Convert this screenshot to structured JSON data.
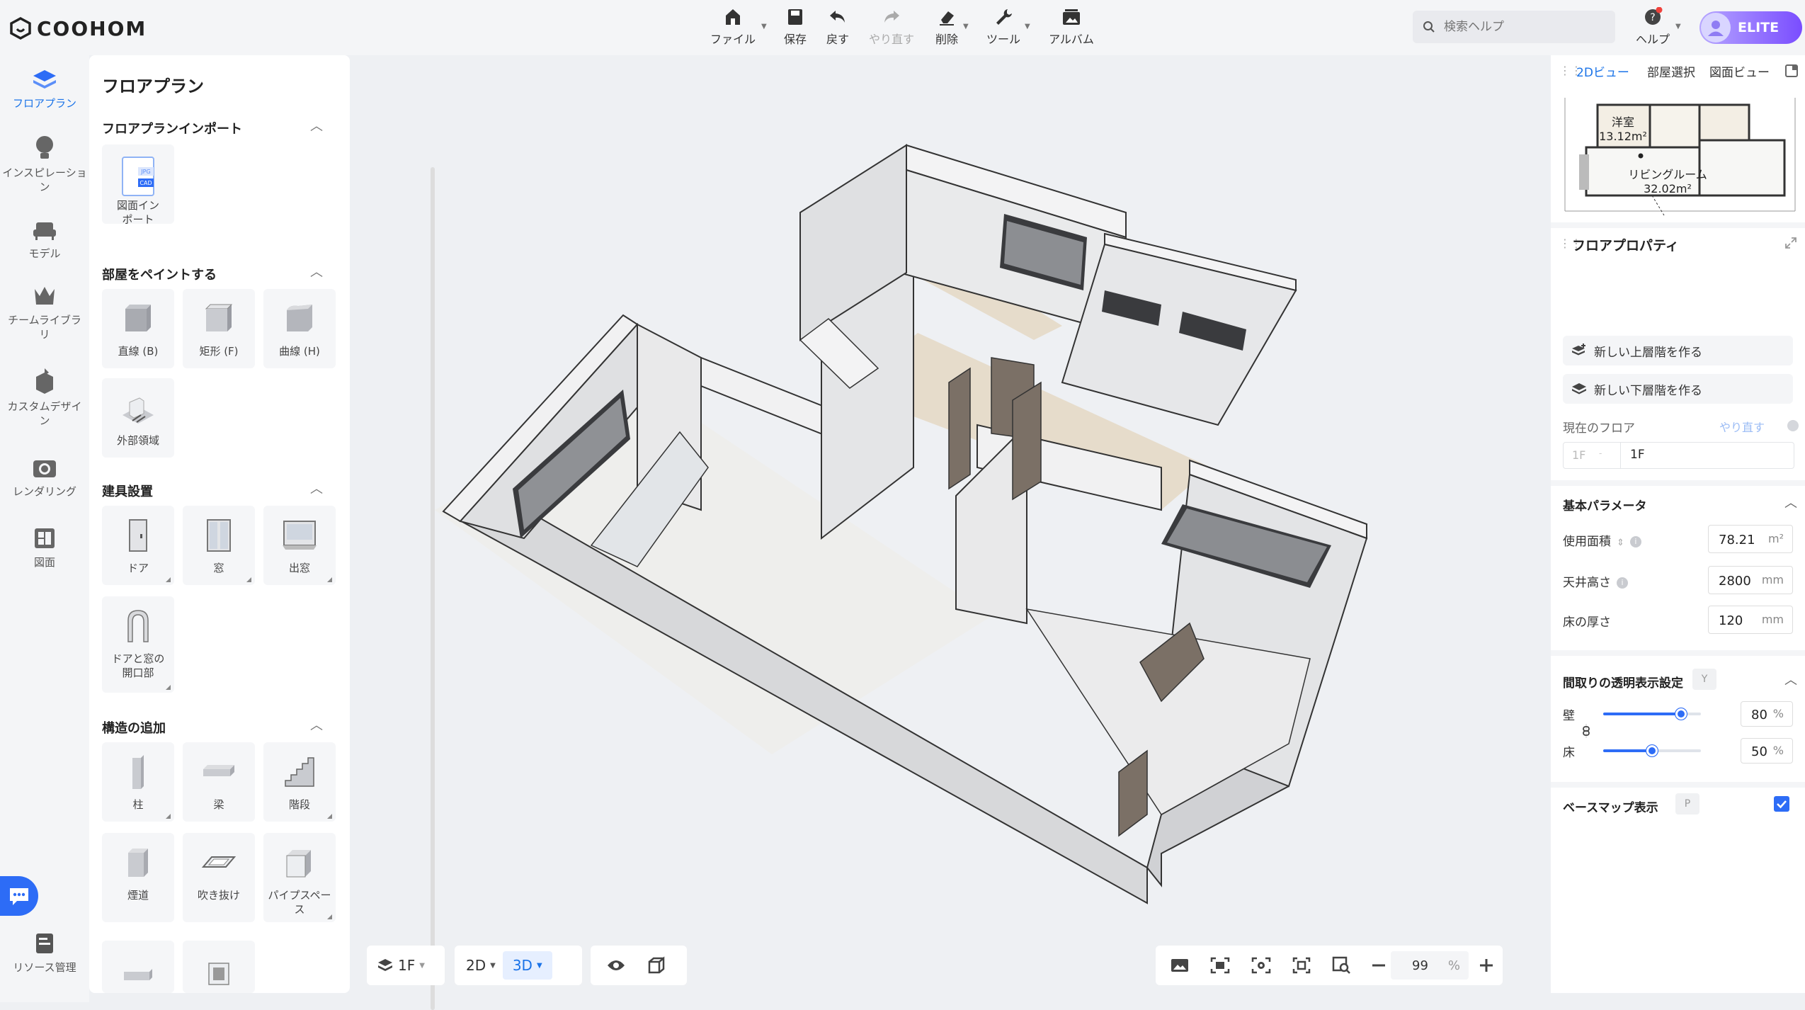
{
  "app": {
    "logo_text": "COOHOM"
  },
  "toolbar": {
    "file": "ファイル",
    "save": "保存",
    "undo": "戻す",
    "redo": "やり直す",
    "delete": "削除",
    "tools": "ツール",
    "album": "アルバム"
  },
  "search": {
    "placeholder": "検索ヘルプ"
  },
  "help": {
    "label": "ヘルプ"
  },
  "account": {
    "badge": "ELITE"
  },
  "rail": {
    "items": [
      {
        "label": "フロアプラン",
        "icon": "floorplan-icon",
        "active": true
      },
      {
        "label": "インスピレーション",
        "icon": "lightbulb-icon"
      },
      {
        "label": "モデル",
        "icon": "sofa-icon"
      },
      {
        "label": "チームライブラリ",
        "icon": "crown-icon"
      },
      {
        "label": "カスタムデザイン",
        "icon": "custom-box-icon"
      },
      {
        "label": "レンダリング",
        "icon": "camera-icon"
      },
      {
        "label": "図面",
        "icon": "drawing-icon"
      }
    ],
    "resource": "リソース管理"
  },
  "left_panel": {
    "title": "フロアプラン",
    "sections": {
      "import": {
        "title": "フロアプランインポート",
        "items": [
          "図面インポート"
        ],
        "file_tags": [
          "JPG",
          "CAD"
        ]
      },
      "paint": {
        "title": "部屋をペイントする",
        "items": [
          "直線 (B)",
          "矩形 (F)",
          "曲線 (H)",
          "外部領域"
        ]
      },
      "fixtures": {
        "title": "建具設置",
        "items": [
          "ドア",
          "窓",
          "出窓",
          "ドアと窓の開口部"
        ]
      },
      "structure": {
        "title": "構造の追加",
        "items": [
          "柱",
          "梁",
          "階段",
          "煙道",
          "吹き抜け",
          "パイプスペース"
        ]
      }
    }
  },
  "right_panel": {
    "tabs": [
      "2Dビュー",
      "部屋選択",
      "図面ビュー"
    ],
    "minimap": {
      "rooms": [
        {
          "name": "洋室",
          "area": "13.12m²"
        },
        {
          "name": "リビングルーム",
          "area": "32.02m²"
        }
      ]
    },
    "floor_props": {
      "title": "フロアプロパティ",
      "new_upper": "新しい上層階を作る",
      "new_lower": "新しい下層階を作る",
      "current_floor_label": "現在のフロア",
      "redo": "やり直す",
      "floor_prefix": "1F",
      "floor_name": "1F"
    },
    "basic": {
      "title": "基本パラメータ",
      "usable_area_label": "使用面積",
      "usable_area": "78.21",
      "usable_area_unit": "m²",
      "ceiling_label": "天井高さ",
      "ceiling": "2800",
      "ceiling_unit": "mm",
      "floor_thickness_label": "床の厚さ",
      "floor_thickness": "120",
      "floor_thickness_unit": "mm"
    },
    "transparency": {
      "title": "間取りの透明表示設定",
      "shortcut": "Y",
      "wall_label": "壁",
      "wall_value": "80",
      "floor_label": "床",
      "floor_value": "50",
      "unit": "%"
    },
    "basemap": {
      "label": "ベースマップ表示",
      "shortcut": "P",
      "checked": true
    }
  },
  "bottom": {
    "floor": "1F",
    "view_2d": "2D",
    "view_3d": "3D",
    "zoom": "99",
    "zoom_unit": "%"
  },
  "colors": {
    "accent": "#2d6cf6",
    "elite": "#7a4dff"
  }
}
